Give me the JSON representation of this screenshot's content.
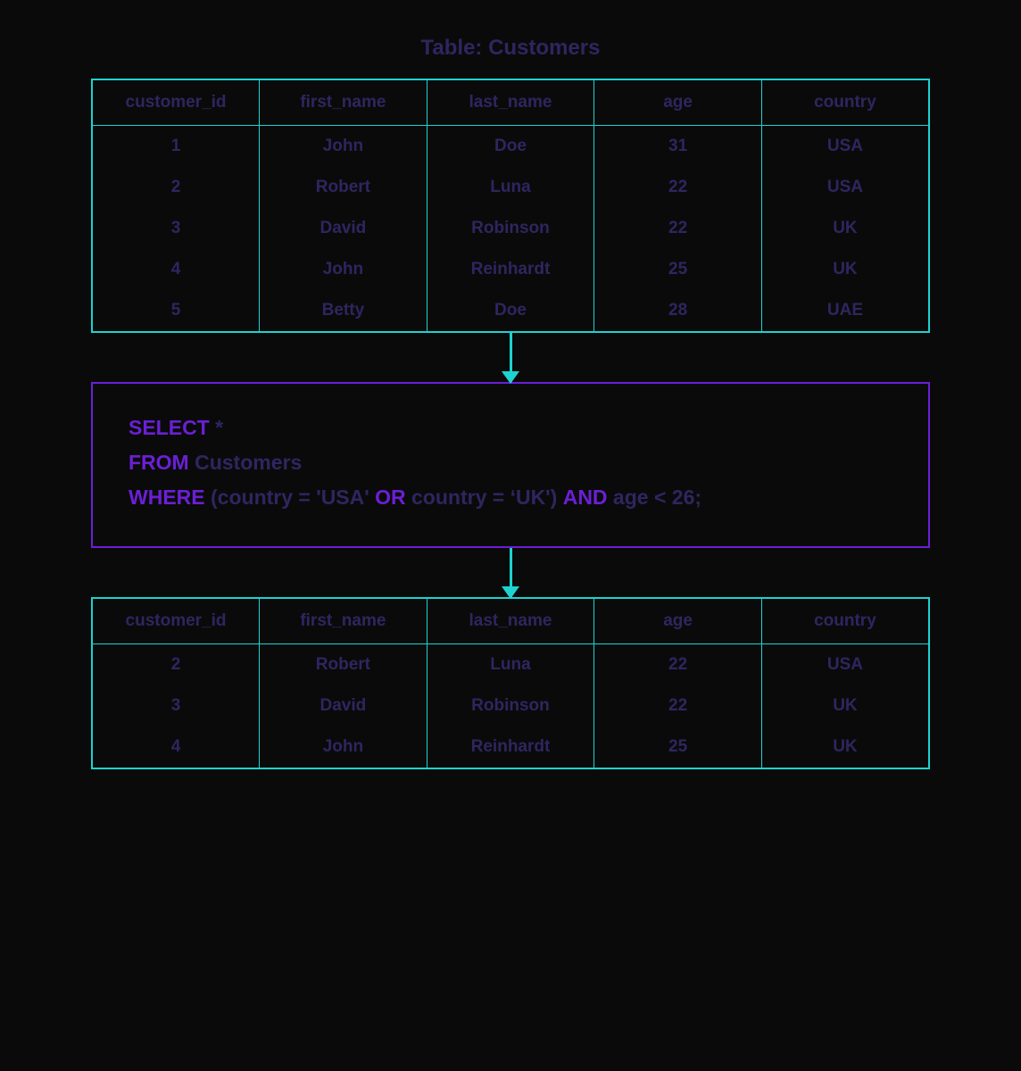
{
  "title": "Table: Customers",
  "columns": [
    "customer_id",
    "first_name",
    "last_name",
    "age",
    "country"
  ],
  "source_rows": [
    {
      "customer_id": "1",
      "first_name": "John",
      "last_name": "Doe",
      "age": "31",
      "country": "USA"
    },
    {
      "customer_id": "2",
      "first_name": "Robert",
      "last_name": "Luna",
      "age": "22",
      "country": "USA"
    },
    {
      "customer_id": "3",
      "first_name": "David",
      "last_name": "Robinson",
      "age": "22",
      "country": "UK"
    },
    {
      "customer_id": "4",
      "first_name": "John",
      "last_name": "Reinhardt",
      "age": "25",
      "country": "UK"
    },
    {
      "customer_id": "5",
      "first_name": "Betty",
      "last_name": "Doe",
      "age": "28",
      "country": "UAE"
    }
  ],
  "sql": {
    "select_kw": "SELECT",
    "select_rest": " *",
    "from_kw": "FROM",
    "from_rest": " Customers",
    "where_kw": "WHERE",
    "where_part1": " (country = 'USA' ",
    "or_kw": "OR",
    "where_part2": " country = ‘UK') ",
    "and_kw": "AND",
    "where_part3": " age < 26;"
  },
  "result_rows": [
    {
      "customer_id": "2",
      "first_name": "Robert",
      "last_name": "Luna",
      "age": "22",
      "country": "USA"
    },
    {
      "customer_id": "3",
      "first_name": "David",
      "last_name": "Robinson",
      "age": "22",
      "country": "UK"
    },
    {
      "customer_id": "4",
      "first_name": "John",
      "last_name": "Reinhardt",
      "age": "25",
      "country": "UK"
    }
  ]
}
